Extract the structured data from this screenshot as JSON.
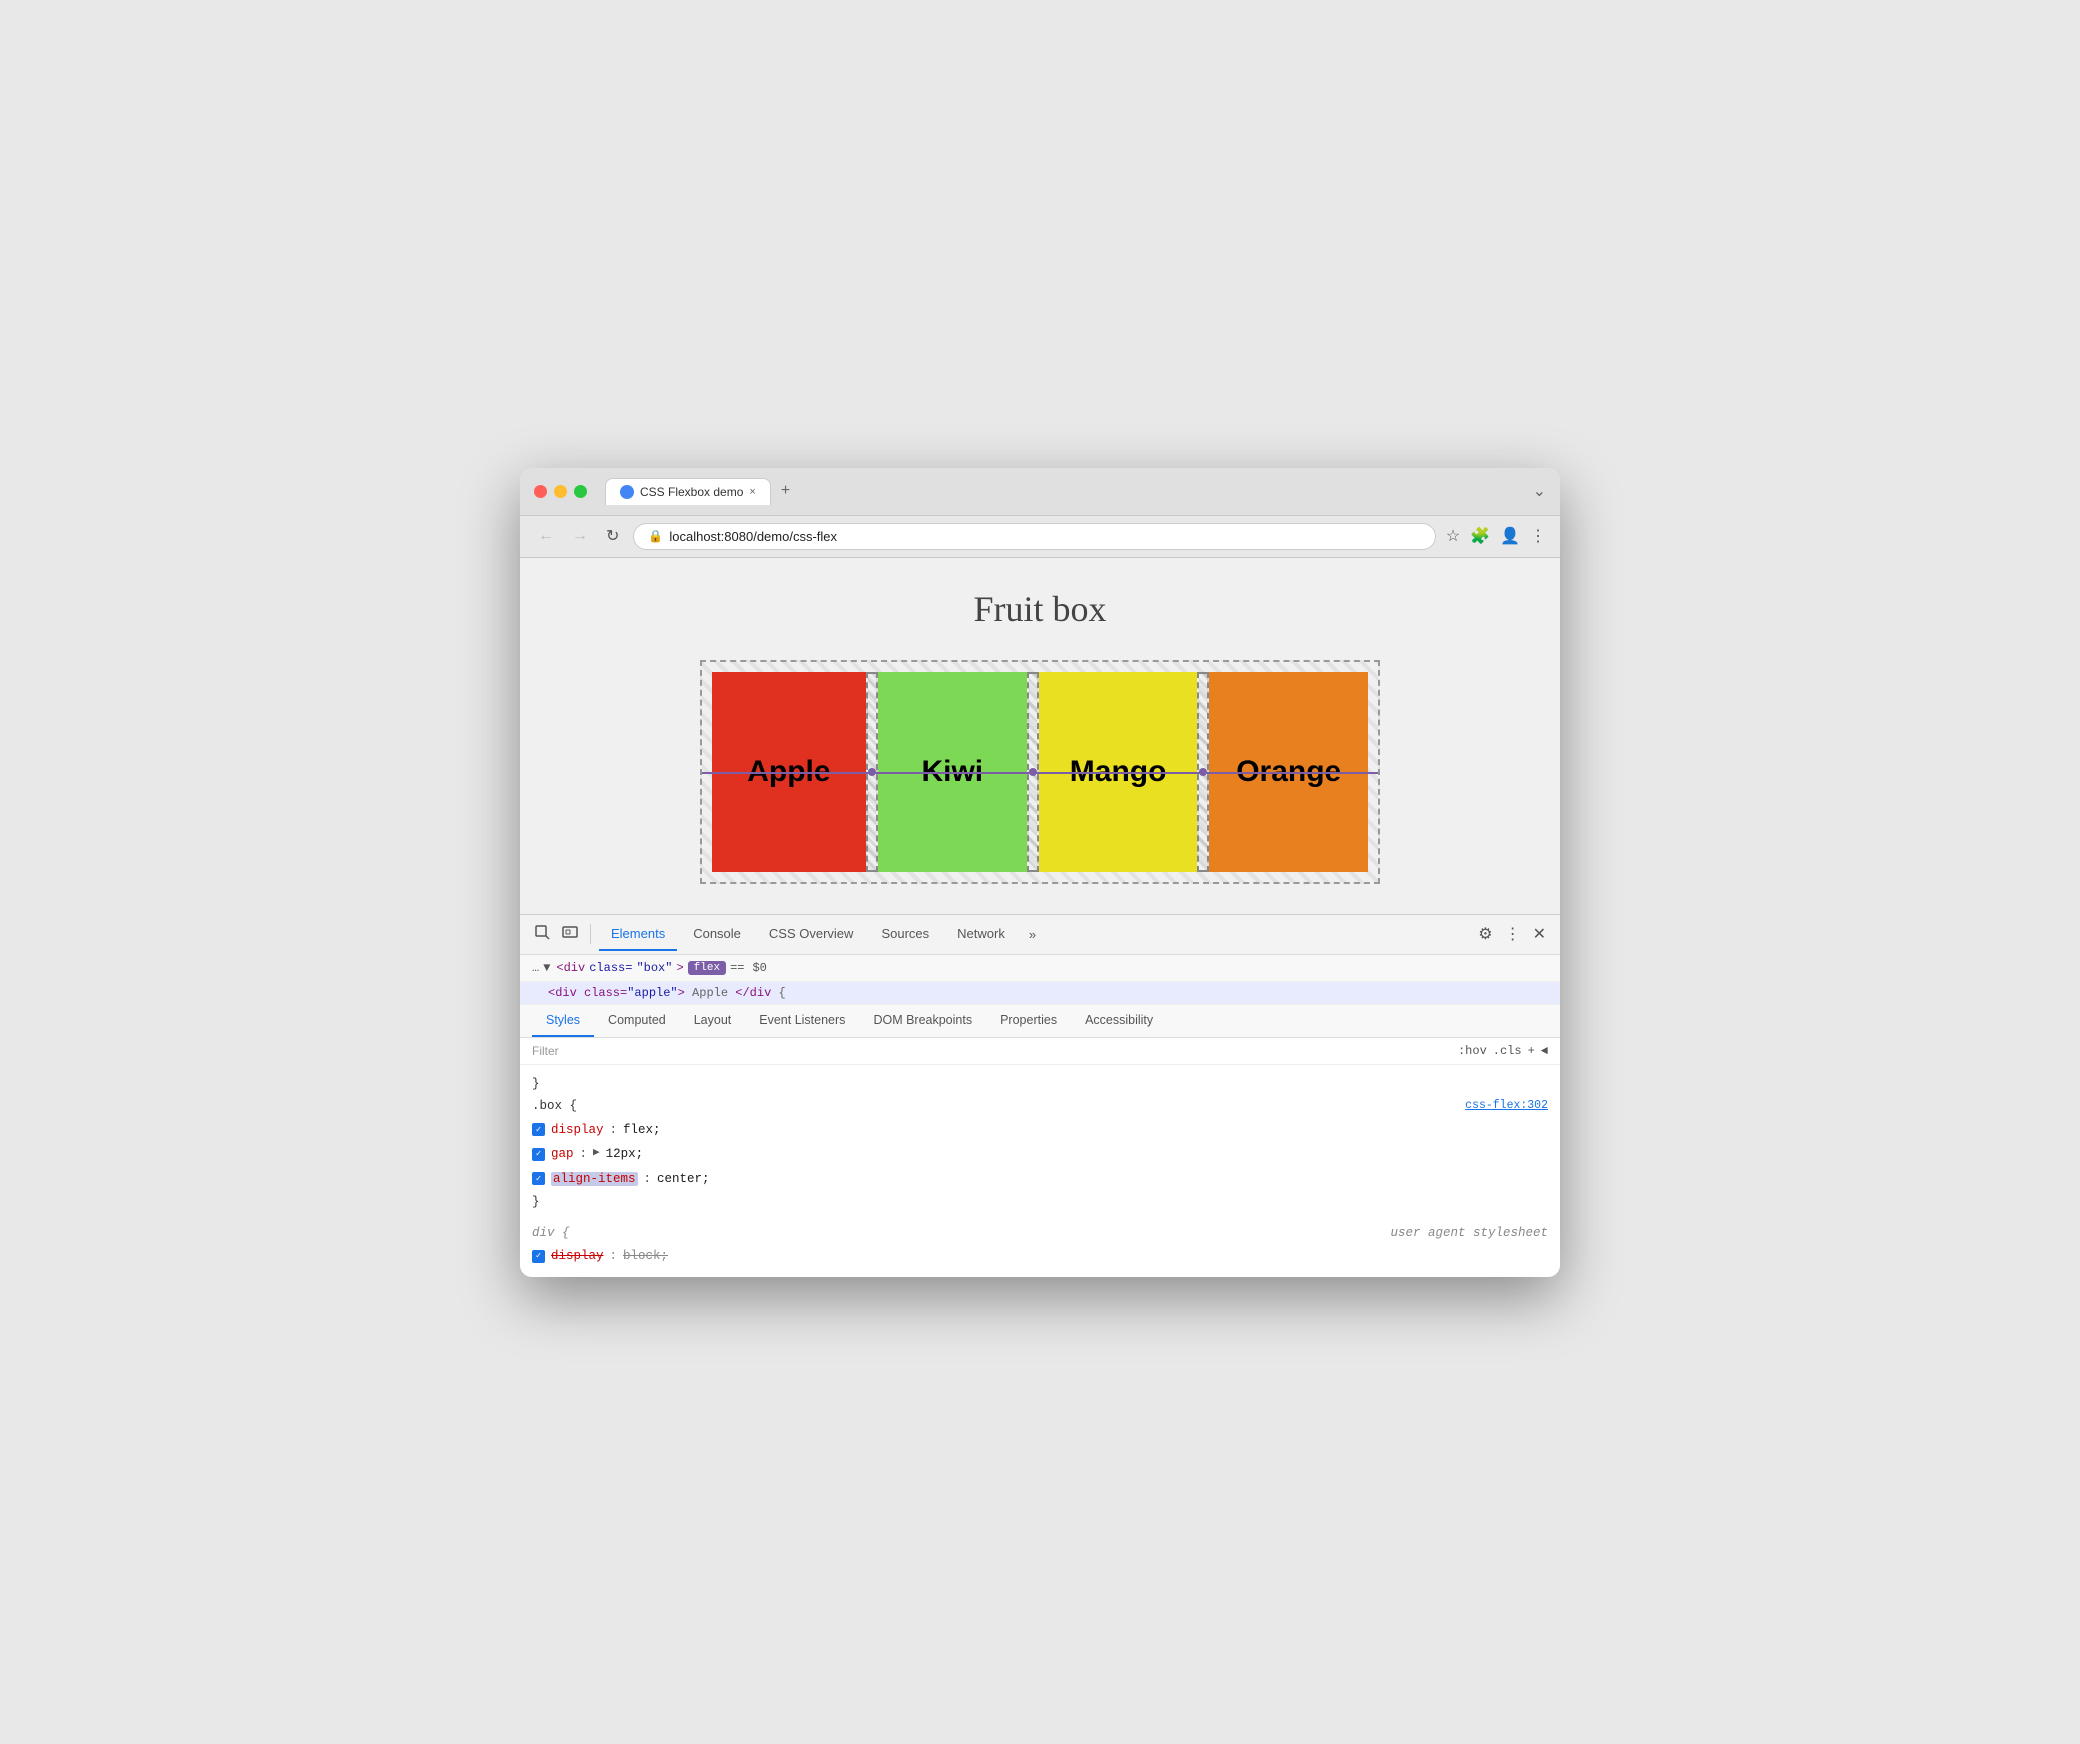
{
  "browser": {
    "traffic_lights": [
      "close",
      "minimize",
      "maximize"
    ],
    "tab": {
      "title": "CSS Flexbox demo",
      "close_label": "×",
      "add_label": "+"
    },
    "address_bar": {
      "url": "localhost:8080/demo/css-flex",
      "host": "localhost",
      "path": ":8080/demo/css-flex"
    },
    "nav": {
      "back": "←",
      "forward": "→",
      "reload": "↻"
    }
  },
  "page": {
    "title": "Fruit box",
    "fruit_items": [
      {
        "label": "Apple",
        "color": "#e03020"
      },
      {
        "label": "Kiwi",
        "color": "#7dd855"
      },
      {
        "label": "Mango",
        "color": "#e8e020"
      },
      {
        "label": "Orange",
        "color": "#e88020"
      }
    ]
  },
  "devtools": {
    "tabs": [
      "Elements",
      "Console",
      "CSS Overview",
      "Sources",
      "Network",
      "»"
    ],
    "active_tab": "Elements",
    "dom_breadcrumb": {
      "dots": "…",
      "tag": "div",
      "class_attr": "class",
      "class_val": "\"box\"",
      "badge": "flex",
      "equals": "==",
      "dollar": "$0"
    },
    "dom_child": "div class=\"apple\"> Apple </div  {",
    "styles_tabs": [
      "Styles",
      "Computed",
      "Layout",
      "Event Listeners",
      "DOM Breakpoints",
      "Properties",
      "Accessibility"
    ],
    "active_styles_tab": "Styles",
    "filter_placeholder": "Filter",
    "filter_actions": [
      ":hov",
      ".cls",
      "+",
      "◄"
    ],
    "css_rules": [
      {
        "close_brace": "}"
      },
      {
        "selector": ".box {",
        "source": "css-flex:302",
        "properties": [
          {
            "enabled": true,
            "prop": "display",
            "val": "flex;"
          },
          {
            "enabled": true,
            "prop": "gap",
            "val": "▶ 12px;",
            "has_arrow": true
          },
          {
            "enabled": true,
            "prop": "align-items",
            "val": "center;",
            "highlight_prop": true
          }
        ],
        "close": "}"
      },
      {
        "selector": "div {",
        "source": "user agent stylesheet",
        "source_italic": true,
        "properties": [
          {
            "enabled": true,
            "prop": "display",
            "val": "block;",
            "strikethrough": true
          }
        ]
      }
    ]
  }
}
